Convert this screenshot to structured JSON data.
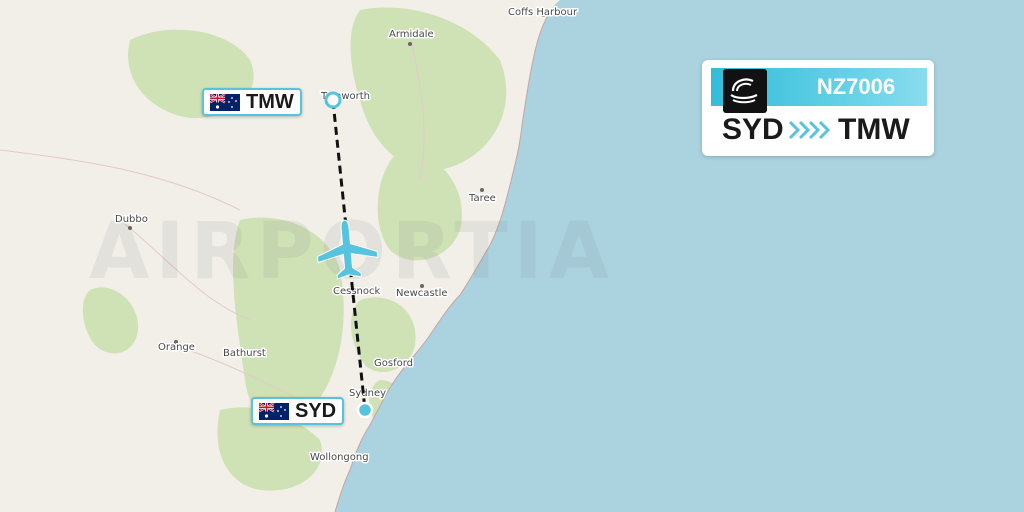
{
  "watermark": "AIRPORTIA",
  "map": {
    "towns": {
      "coffs_harbour": "Coffs Harbour",
      "armidale": "Armidale",
      "tamworth": "Tamworth",
      "taree": "Taree",
      "dubbo": "Dubbo",
      "cessnock": "Cessnock",
      "newcastle": "Newcastle",
      "orange": "Orange",
      "bathurst": "Bathurst",
      "gosford": "Gosford",
      "sydney": "Sydney",
      "wollongong": "Wollongong"
    }
  },
  "airports": {
    "origin": {
      "code": "SYD",
      "flag_icon": "australia-flag-icon"
    },
    "destination": {
      "code": "TMW",
      "flag_icon": "australia-flag-icon"
    }
  },
  "flight_card": {
    "flight_number": "NZ7006",
    "from": "SYD",
    "to": "TMW",
    "airline_logo_icon": "air-new-zealand-koru-icon",
    "arrow_icon": "chevrons-right-icon"
  },
  "colors": {
    "sea": "#aad3df",
    "land": "#f2efe9",
    "forest": "#cfe2b5",
    "accent": "#58c3df",
    "route_line": "#111111",
    "plane": "#58c3df"
  }
}
